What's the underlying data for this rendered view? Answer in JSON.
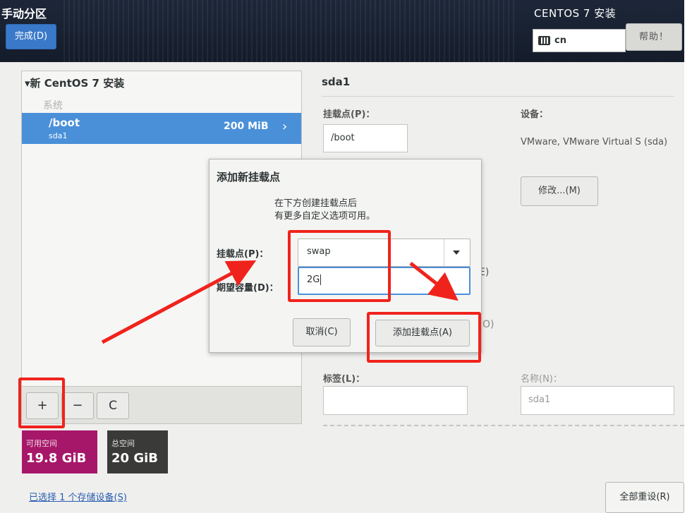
{
  "header": {
    "page_title": "手动分区",
    "done_button": "完成(D)",
    "install_title": "CENTOS 7 安装",
    "keyboard_layout": "cn",
    "help_button": "帮助！"
  },
  "left_panel": {
    "install_heading": "▾新 CentOS 7 安装",
    "section_system": "系统",
    "partitions": [
      {
        "mount": "/boot",
        "device": "sda1",
        "size": "200 MiB",
        "selected": true
      }
    ],
    "toolbar": {
      "add": "+",
      "remove": "−",
      "refresh": "C"
    }
  },
  "space": {
    "available_label": "可用空间",
    "available_value": "19.8 GiB",
    "available_color": "#a71769",
    "total_label": "总空间",
    "total_value": "20 GiB",
    "total_color": "#3a3a38"
  },
  "footer": {
    "storage_link": "已选择 1 个存储设备(S)",
    "reset_button": "全部重设(R)"
  },
  "details": {
    "title": "sda1",
    "mount_label": "挂载点(P)：",
    "mount_value": "/boot",
    "device_label": "设备：",
    "device_text": "VMware, VMware Virtual S (sda)",
    "modify_button": "修改...(M)",
    "peek_e": "E)",
    "peek_o": "O)",
    "tag_label": "标签(L)：",
    "tag_value": "",
    "name_label": "名称(N)：",
    "name_value": "sda1"
  },
  "dialog": {
    "title": "添加新挂载点",
    "description_line1": "在下方创建挂载点后",
    "description_line2": "有更多自定义选项可用。",
    "mount_label": "挂载点(P)：",
    "mount_value": "swap",
    "capacity_label": "期望容量(D)：",
    "capacity_value": "2G",
    "cancel_button": "取消(C)",
    "add_button": "添加挂载点(A)"
  },
  "colors": {
    "accent_blue": "#4a90d9",
    "annotation_red": "#f0231c"
  }
}
